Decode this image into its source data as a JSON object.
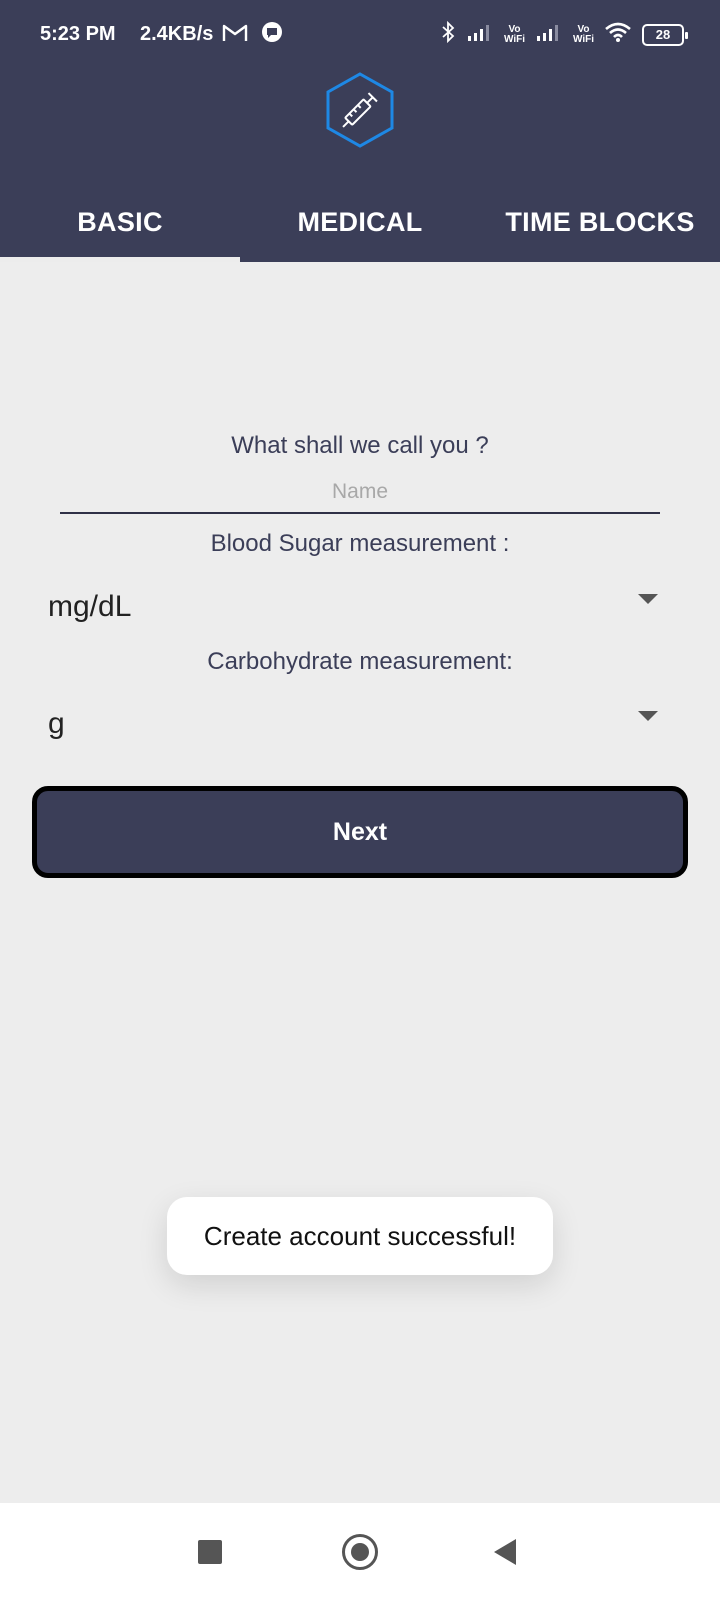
{
  "status_bar": {
    "time": "5:23 PM",
    "speed": "2.4KB/s",
    "volte1_top": "Vo",
    "volte1_bottom": "WiFi",
    "volte2_top": "Vo",
    "volte2_bottom": "WiFi",
    "battery": "28"
  },
  "tabs": [
    {
      "label": "BASIC",
      "active": true
    },
    {
      "label": "MEDICAL",
      "active": false
    },
    {
      "label": "TIME BLOCKS",
      "active": false
    }
  ],
  "form": {
    "name_prompt": "What shall we call you ?",
    "name_placeholder": "Name",
    "name_value": "",
    "blood_sugar_label": "Blood Sugar measurement :",
    "blood_sugar_value": "mg/dL",
    "carb_label": "Carbohydrate measurement:",
    "carb_value": "g",
    "next_label": "Next"
  },
  "toast": {
    "message": "Create account successful!"
  },
  "colors": {
    "header_bg": "#3b3e58",
    "page_bg": "#ededed",
    "logo_accent": "#1e88e5"
  }
}
